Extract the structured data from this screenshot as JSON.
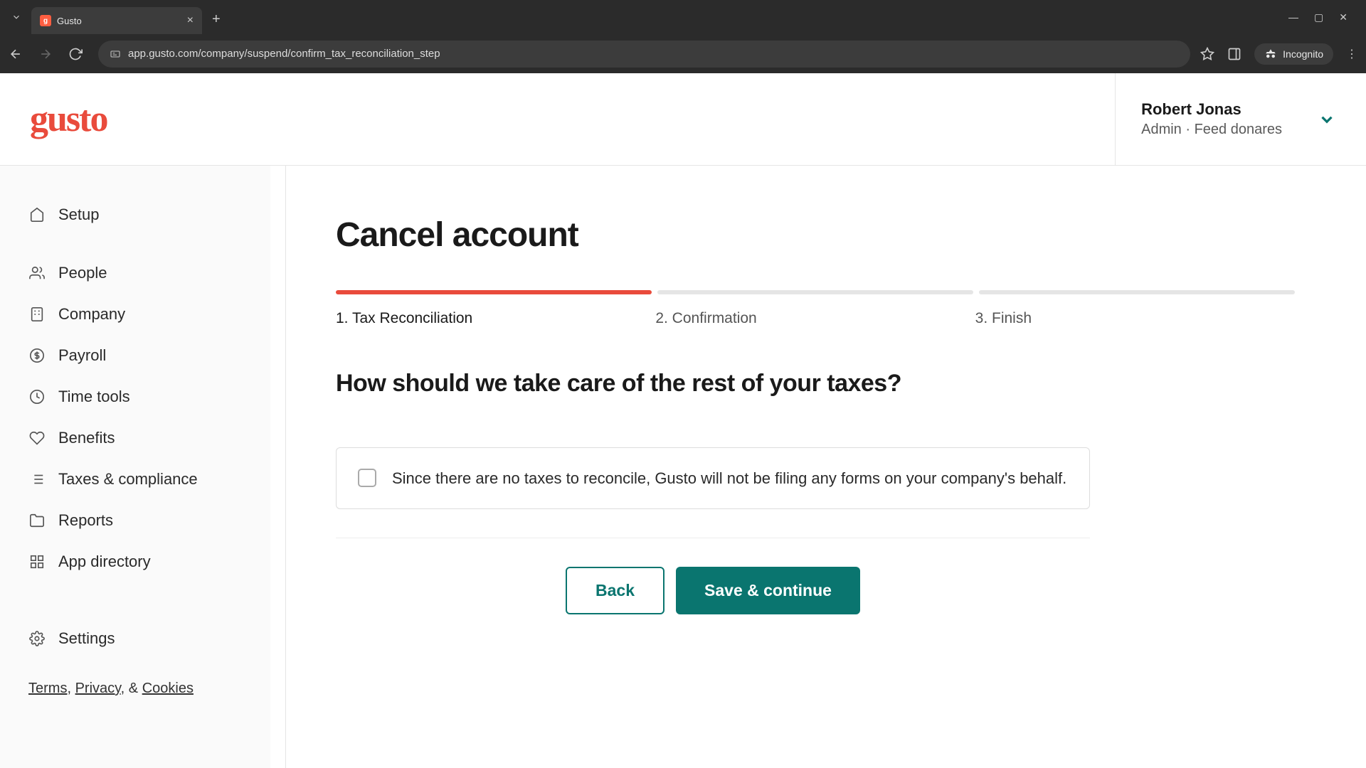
{
  "browser": {
    "tab_title": "Gusto",
    "url": "app.gusto.com/company/suspend/confirm_tax_reconciliation_step",
    "incognito_label": "Incognito"
  },
  "header": {
    "logo_text": "gusto",
    "user_name": "Robert Jonas",
    "user_role": "Admin · Feed donares"
  },
  "sidebar": {
    "items": [
      {
        "label": "Setup",
        "icon": "home"
      },
      {
        "label": "People",
        "icon": "people"
      },
      {
        "label": "Company",
        "icon": "building"
      },
      {
        "label": "Payroll",
        "icon": "dollar"
      },
      {
        "label": "Time tools",
        "icon": "clock"
      },
      {
        "label": "Benefits",
        "icon": "heart"
      },
      {
        "label": "Taxes & compliance",
        "icon": "list"
      },
      {
        "label": "Reports",
        "icon": "folder"
      },
      {
        "label": "App directory",
        "icon": "grid"
      },
      {
        "label": "Settings",
        "icon": "gear"
      }
    ]
  },
  "footer": {
    "terms": "Terms",
    "privacy": "Privacy",
    "cookies": "Cookies",
    "sep1": ", ",
    "sep2": ", & "
  },
  "main": {
    "title": "Cancel account",
    "steps": [
      {
        "label": "1. Tax Reconciliation",
        "active": true
      },
      {
        "label": "2. Confirmation",
        "active": false
      },
      {
        "label": "3. Finish",
        "active": false
      }
    ],
    "question": "How should we take care of the rest of your taxes?",
    "checkbox_text": "Since there are no taxes to reconcile, Gusto will not be filing any forms on your company's behalf.",
    "back_label": "Back",
    "continue_label": "Save & continue"
  }
}
